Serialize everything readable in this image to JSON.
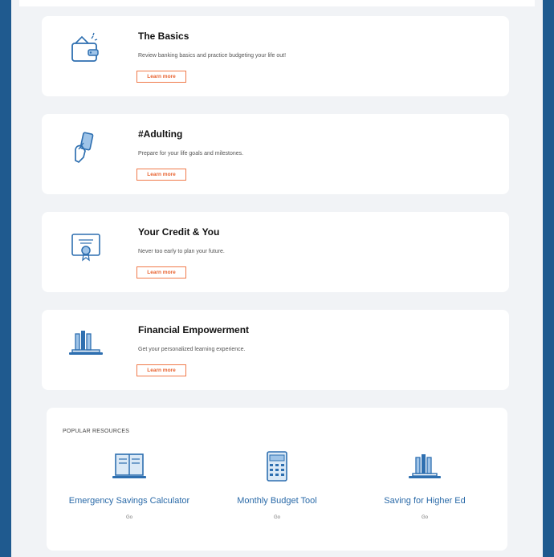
{
  "cards": [
    {
      "title": "The Basics",
      "description": "Review banking basics and practice budgeting your life out!",
      "button": "Learn more",
      "icon": "wallet-icon"
    },
    {
      "title": "#Adulting",
      "description": "Prepare for your life goals and milestones.",
      "button": "Learn more",
      "icon": "hand-card-icon"
    },
    {
      "title": "Your Credit & You",
      "description": "Never too early to plan your future.",
      "button": "Learn more",
      "icon": "certificate-icon"
    },
    {
      "title": "Financial Empowerment",
      "description": "Get your personalized learning experience.",
      "button": "Learn more",
      "icon": "laptop-books-icon"
    }
  ],
  "resources": {
    "heading": "POPULAR RESOURCES",
    "items": [
      {
        "label": "Emergency Savings Calculator",
        "link": "Go",
        "icon": "open-book-icon"
      },
      {
        "label": "Monthly Budget Tool",
        "link": "Go",
        "icon": "calculator-icon"
      },
      {
        "label": "Saving for Higher Ed",
        "link": "Go",
        "icon": "laptop-books-icon"
      }
    ]
  },
  "colors": {
    "brand": "#1f5a8f",
    "accent": "#f07a4a",
    "link": "#2a6aa8",
    "icon": "#2e6fb0"
  }
}
